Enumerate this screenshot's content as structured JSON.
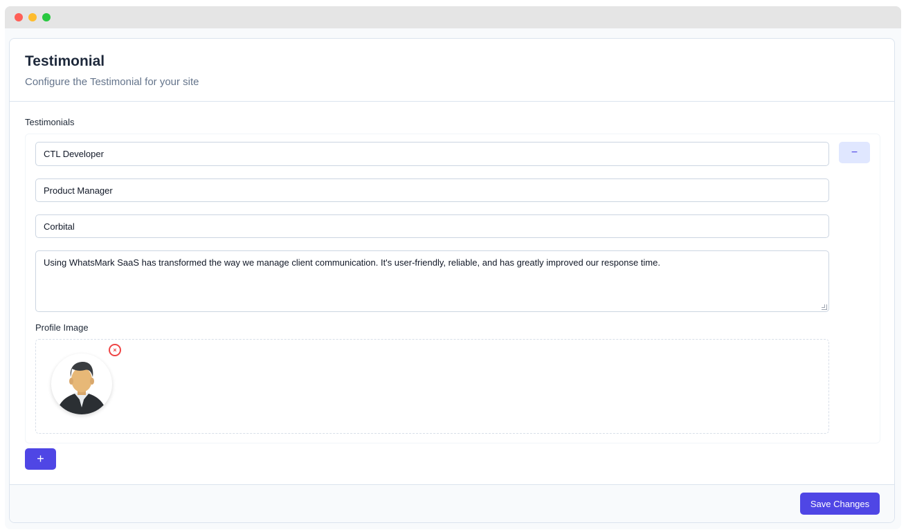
{
  "page": {
    "title": "Testimonial",
    "subtitle": "Configure the Testimonial for your site"
  },
  "testimonials": {
    "label": "Testimonials",
    "items": [
      {
        "name": "CTL Developer",
        "position": "Product Manager",
        "company": "Corbital",
        "message": "Using WhatsMark SaaS has transformed the way we manage client communication. It's user-friendly, reliable, and has greatly improved our response time.",
        "profile_image_label": "Profile Image",
        "remove_label": "−",
        "remove_image_label": "×",
        "avatar_icon": "businessman-avatar-icon"
      }
    ],
    "add_label": "+"
  },
  "footer": {
    "save_label": "Save Changes"
  },
  "colors": {
    "accent": "#4f46e5",
    "accent_light": "#e0e7ff",
    "danger": "#ef4444"
  }
}
